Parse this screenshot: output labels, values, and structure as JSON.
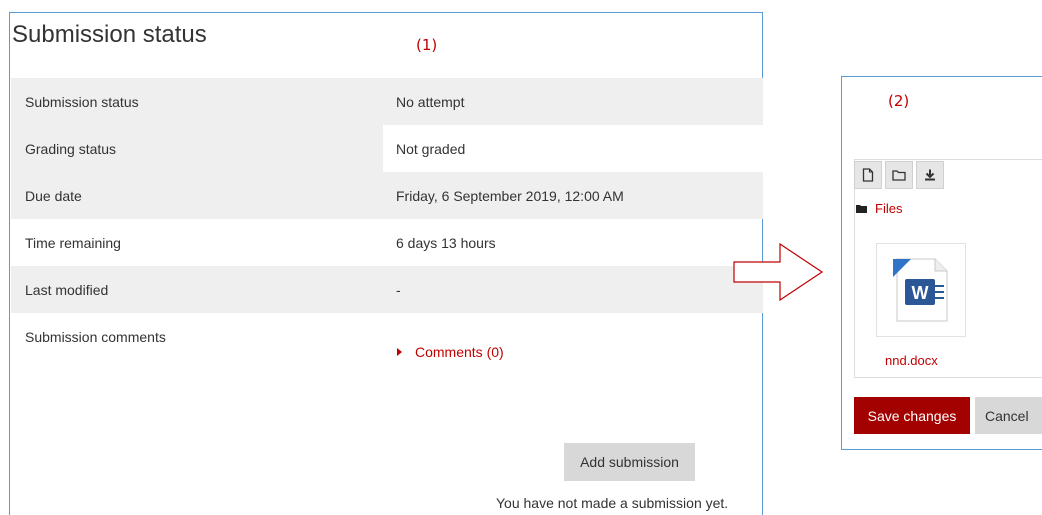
{
  "annotations": {
    "left": "(1)",
    "right": "(2)"
  },
  "submission": {
    "title": "Submission status",
    "rows": [
      {
        "label": "Submission status",
        "value": "No attempt"
      },
      {
        "label": "Grading status",
        "value": "Not graded"
      },
      {
        "label": "Due date",
        "value": "Friday, 6 September 2019, 12:00 AM"
      },
      {
        "label": "Time remaining",
        "value": "6 days 13 hours"
      },
      {
        "label": "Last modified",
        "value": "-"
      },
      {
        "label": "Submission comments",
        "value": "Comments (0)"
      }
    ],
    "add_button": "Add submission",
    "no_submission_note": "You have not made a submission yet."
  },
  "file_picker": {
    "toolbar": [
      "new-file-icon",
      "new-folder-icon",
      "download-icon"
    ],
    "breadcrumb": "Files",
    "file": {
      "name": "nnd.docx",
      "icon": "word-document-icon"
    },
    "save_button": "Save changes",
    "cancel_button": "Cancel"
  },
  "colors": {
    "accent": "#c00000",
    "save_button": "#a30000",
    "panel_border": "#5b9bd5"
  }
}
